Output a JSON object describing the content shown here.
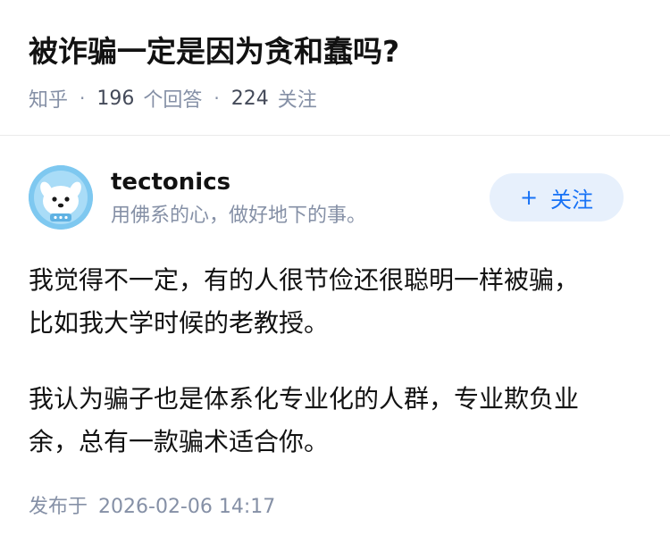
{
  "question": {
    "title": "被诈骗一定是因为贪和蠢吗?",
    "source": "知乎",
    "separator": "·",
    "answer_count": "196",
    "answer_label": "个回答",
    "follower_count": "224",
    "follower_label": "关注"
  },
  "answer": {
    "author": {
      "name": "tectonics",
      "bio": "用佛系的心，做好地下的事。",
      "avatar_icon": "dog-astronaut-avatar-icon"
    },
    "follow_button": {
      "icon": "+",
      "label": "关注"
    },
    "paragraphs": [
      "我觉得不一定，有的人很节俭还很聪明一样被骗，\n比如我大学时候的老教授。",
      "我认为骗子也是体系化专业化的人群，专业欺负业\n余，总有一款骗术适合你。"
    ],
    "publish_label": "发布于",
    "publish_time": "2026-02-06 14:17"
  },
  "colors": {
    "meta_gray": "#8590a6",
    "accent_blue": "#1772f6",
    "follow_bg": "#e7f0fc",
    "avatar_bg": "#7ec8f0"
  }
}
